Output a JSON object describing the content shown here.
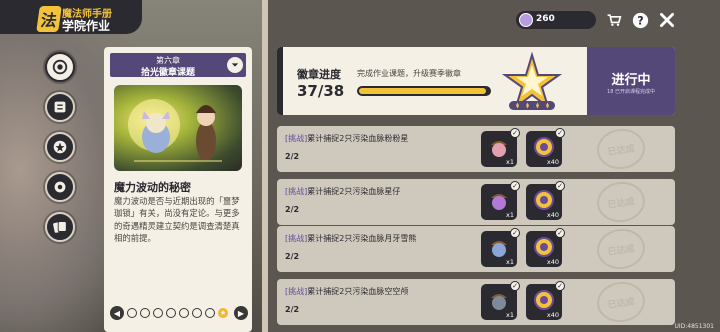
{
  "header": {
    "logo_glyph": "法",
    "subtitle": "魔法师手册",
    "title": "学院作业"
  },
  "nav": {
    "items": [
      {
        "name": "nav-target-icon",
        "active": true
      },
      {
        "name": "nav-scroll-icon",
        "active": false
      },
      {
        "name": "nav-badge-icon",
        "active": false
      },
      {
        "name": "nav-gear-icon",
        "active": false
      },
      {
        "name": "nav-cards-icon",
        "active": false
      }
    ]
  },
  "chapter": {
    "number": "第六章",
    "name": "拾光徽章课题",
    "story_title": "魔力波动的秘密",
    "story_body": "魔力波动是否与近期出现的「噩梦珈锁」有关，尚没有定论。与更多的奇遇精灵建立契约是调查清楚真相的前提。",
    "pager": {
      "prev": "◀",
      "next": "▶",
      "star": "★"
    }
  },
  "topbar": {
    "currency": "260",
    "currency_color": "#b79be0"
  },
  "badge_progress": {
    "title": "徽章进度",
    "description": "完成作业课题，升级赛季徽章",
    "current": 37,
    "total": 38,
    "count_text": "37/38",
    "status": "进行中",
    "status_sub": "18 已开启课程完成中",
    "accent": "#534878",
    "bar_color": "#f2c23a"
  },
  "tasks": [
    {
      "tag": "[挑战]",
      "text": "累计捕捉2只污染血脉粉粉星",
      "count": "2/2",
      "rewards": [
        {
          "icon": "acorn-item-icon",
          "qty": "x1"
        },
        {
          "icon": "gold-coin-item-icon",
          "qty": "x40"
        }
      ],
      "stamp": "已达成",
      "pet_color": "#e0a0b0"
    },
    {
      "tag": "[挑战]",
      "text": "累计捕捉2只污染血脉星仔",
      "count": "2/2",
      "rewards": [
        {
          "icon": "acorn-item-icon",
          "qty": "x1"
        },
        {
          "icon": "gold-coin-item-icon",
          "qty": "x40"
        }
      ],
      "stamp": "已达成",
      "pet_color": "#b07ad6"
    },
    {
      "tag": "[挑战]",
      "text": "累计捕捉2只污染血脉月牙雪熊",
      "count": "2/2",
      "rewards": [
        {
          "icon": "acorn-item-icon",
          "qty": "x1"
        },
        {
          "icon": "gold-coin-item-icon",
          "qty": "x40"
        }
      ],
      "stamp": "已达成",
      "pet_color": "#8aa6d6"
    },
    {
      "tag": "[挑战]",
      "text": "累计捕捉2只污染血脉空空颅",
      "count": "2/2",
      "rewards": [
        {
          "icon": "acorn-item-icon",
          "qty": "x1"
        },
        {
          "icon": "gold-coin-item-icon",
          "qty": "x40"
        }
      ],
      "stamp": "已达成",
      "pet_color": "#7e8a9a"
    }
  ],
  "uid": "UID:4851301"
}
